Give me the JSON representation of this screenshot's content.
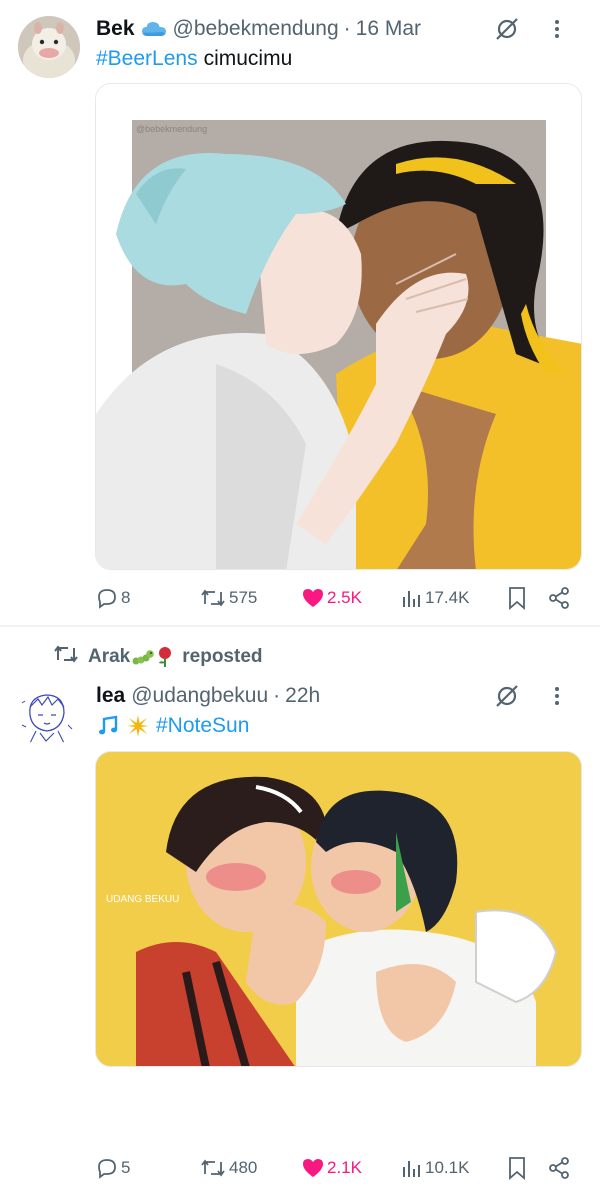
{
  "tweets": [
    {
      "display_name": "Bek",
      "handle": "@bebekmendung",
      "time": "16 Mar",
      "hashtag": "#BeerLens",
      "text": "cimucimu",
      "media_watermark": "@bebekmendung",
      "stats": {
        "replies": "8",
        "reposts": "575",
        "likes": "2.5K",
        "views": "17.4K"
      }
    },
    {
      "reposted_by": "Arak",
      "reposted_label": "reposted",
      "display_name": "lea",
      "handle": "@udangbekuu",
      "time": "22h",
      "hashtag": "#NoteSun",
      "media_watermark": "UDANG BEKUU",
      "stats": {
        "replies": "5",
        "reposts": "480",
        "likes": "2.1K",
        "views": "10.1K"
      }
    }
  ],
  "colors": {
    "accent": "#1d9bf0",
    "like": "#f91880",
    "muted": "#536471",
    "art_bg_2": "#f2cd4a"
  },
  "icons": [
    "cloud-icon",
    "grok-icon",
    "more-icon",
    "reply-icon",
    "repost-icon",
    "like-icon",
    "views-icon",
    "bookmark-icon",
    "share-icon",
    "music-note-icon",
    "sparkle-sun-icon",
    "caterpillar-icon",
    "rose-icon"
  ],
  "separator": "·"
}
